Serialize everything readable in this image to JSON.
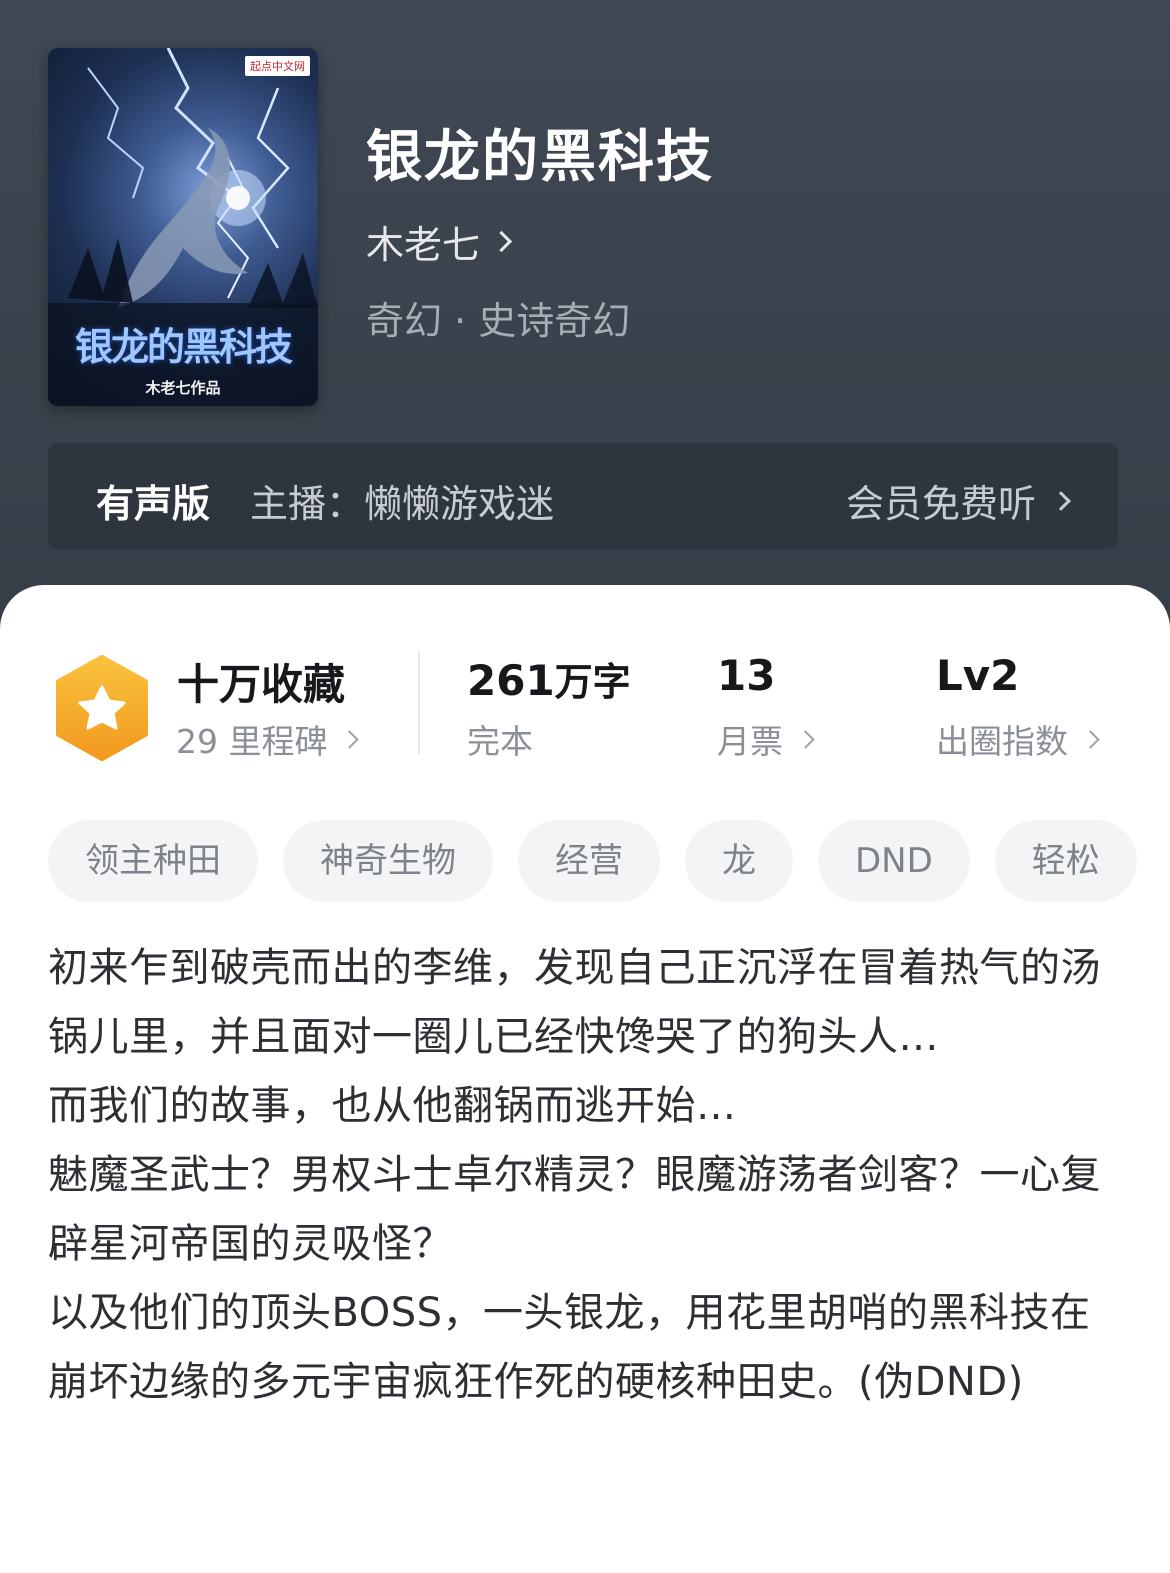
{
  "book": {
    "title": "银龙的黑科技",
    "author": "木老七",
    "genre": "奇幻 · 史诗奇幻",
    "cover": {
      "publisher": "起点中文网",
      "title": "银龙的黑科技",
      "author_credit": "木老七作品"
    }
  },
  "audio": {
    "label": "有声版",
    "host": "主播：懒懒游戏迷",
    "action": "会员免费听"
  },
  "stats": {
    "collection": {
      "title": "十万收藏",
      "sub": "29 里程碑"
    },
    "words": {
      "number": "261",
      "unit": "万字",
      "sub": "完本"
    },
    "monthly": {
      "number": "13",
      "sub": "月票"
    },
    "index": {
      "number": "Lv2",
      "sub": "出圈指数"
    }
  },
  "tags": [
    "领主种田",
    "神奇生物",
    "经营",
    "龙",
    "DND",
    "轻松"
  ],
  "synopsis": [
    "初来乍到破壳而出的李维，发现自己正沉浮在冒着热气的汤锅儿里，并且面对一圈儿已经快馋哭了的狗头人…",
    "而我们的故事，也从他翻锅而逃开始…",
    "魅魔圣武士？男权斗士卓尔精灵？眼魔游荡者剑客？一心复辟星河帝国的灵吸怪？",
    "以及他们的顶头BOSS，一头银龙，用花里胡哨的黑科技在崩坏边缘的多元宇宙疯狂作死的硬核种田史。(伪DND)"
  ],
  "colors": {
    "header_bg": "#3b434e",
    "audio_bar_bg": "#2e353e",
    "badge_orange": "#f5a623",
    "tag_bg": "#f3f4f6"
  },
  "icons": {
    "badge": "star-hexagon-icon",
    "chevron": "chevron-right-icon"
  }
}
